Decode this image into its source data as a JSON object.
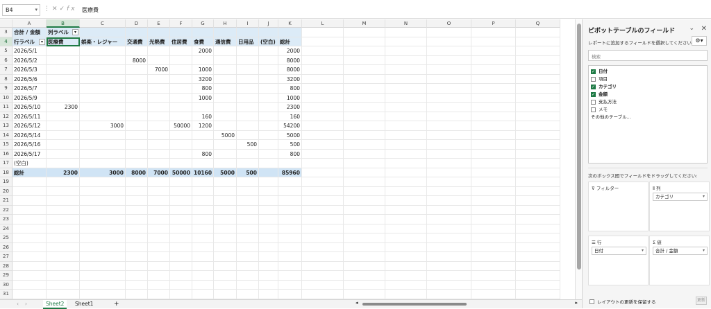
{
  "formula_bar": {
    "name_box": "B4",
    "formula": "医療費",
    "fx": "fx"
  },
  "columns": [
    "A",
    "B",
    "C",
    "D",
    "E",
    "F",
    "G",
    "H",
    "I",
    "J",
    "K",
    "L",
    "M",
    "N",
    "O",
    "P",
    "Q"
  ],
  "selected_column": "B",
  "selected_row": 4,
  "row_numbers": [
    3,
    4,
    5,
    6,
    7,
    8,
    9,
    10,
    11,
    12,
    13,
    14,
    15,
    16,
    17,
    18,
    19,
    20,
    21,
    22,
    23,
    24,
    25,
    26,
    27,
    28,
    29,
    30,
    31
  ],
  "pivot": {
    "corner_label": "合計 / 金額",
    "col_label": "列ラベル",
    "row_label": "行ラベル",
    "headers": [
      "医療費",
      "娯楽・レジャー",
      "交通費",
      "光熱費",
      "住居費",
      "食費",
      "通信費",
      "日用品",
      "(空白)",
      "総計"
    ],
    "rows": [
      {
        "label": "2026/5/1",
        "values": [
          "",
          "",
          "",
          "",
          "",
          "2000",
          "",
          "",
          "",
          "2000"
        ]
      },
      {
        "label": "2026/5/2",
        "values": [
          "",
          "",
          "8000",
          "",
          "",
          "",
          "",
          "",
          "",
          "8000"
        ]
      },
      {
        "label": "2026/5/3",
        "values": [
          "",
          "",
          "",
          "7000",
          "",
          "1000",
          "",
          "",
          "",
          "8000"
        ]
      },
      {
        "label": "2026/5/6",
        "values": [
          "",
          "",
          "",
          "",
          "",
          "3200",
          "",
          "",
          "",
          "3200"
        ]
      },
      {
        "label": "2026/5/7",
        "values": [
          "",
          "",
          "",
          "",
          "",
          "800",
          "",
          "",
          "",
          "800"
        ]
      },
      {
        "label": "2026/5/9",
        "values": [
          "",
          "",
          "",
          "",
          "",
          "1000",
          "",
          "",
          "",
          "1000"
        ]
      },
      {
        "label": "2026/5/10",
        "values": [
          "2300",
          "",
          "",
          "",
          "",
          "",
          "",
          "",
          "",
          "2300"
        ]
      },
      {
        "label": "2026/5/11",
        "values": [
          "",
          "",
          "",
          "",
          "",
          "160",
          "",
          "",
          "",
          "160"
        ]
      },
      {
        "label": "2026/5/12",
        "values": [
          "",
          "3000",
          "",
          "",
          "50000",
          "1200",
          "",
          "",
          "",
          "54200"
        ]
      },
      {
        "label": "2026/5/14",
        "values": [
          "",
          "",
          "",
          "",
          "",
          "",
          "5000",
          "",
          "",
          "5000"
        ]
      },
      {
        "label": "2026/5/16",
        "values": [
          "",
          "",
          "",
          "",
          "",
          "",
          "",
          "500",
          "",
          "500"
        ]
      },
      {
        "label": "2026/5/17",
        "values": [
          "",
          "",
          "",
          "",
          "",
          "800",
          "",
          "",
          "",
          "800"
        ]
      },
      {
        "label": "(空白)",
        "values": [
          "",
          "",
          "",
          "",
          "",
          "",
          "",
          "",
          "",
          ""
        ]
      }
    ],
    "total_label": "総計",
    "totals": [
      "2300",
      "3000",
      "8000",
      "7000",
      "50000",
      "10160",
      "5000",
      "500",
      "",
      "85960"
    ]
  },
  "sheet_tabs": [
    "Sheet2",
    "Sheet1"
  ],
  "add_sheet": "+",
  "pane": {
    "title": "ピボットテーブルのフィールド",
    "subtitle": "レポートに追加するフィールドを選択してください:",
    "search_placeholder": "検索",
    "fields": [
      {
        "name": "日付",
        "checked": true
      },
      {
        "name": "項目",
        "checked": false
      },
      {
        "name": "カテゴリ",
        "checked": true
      },
      {
        "name": "金額",
        "checked": true
      },
      {
        "name": "支払方法",
        "checked": false
      },
      {
        "name": "メモ",
        "checked": false
      }
    ],
    "more_tables": "その他のテーブル...",
    "drag_msg": "次のボックス間でフィールドをドラッグしてください:",
    "filter_label": "フィルター",
    "columns_label": "列",
    "columns_value": "カテゴリ",
    "rows_label": "行",
    "rows_value": "日付",
    "values_label": "値",
    "values_value": "合計 / 金額",
    "defer_label": "レイアウトの更新を保留する",
    "update_label": "更新"
  }
}
